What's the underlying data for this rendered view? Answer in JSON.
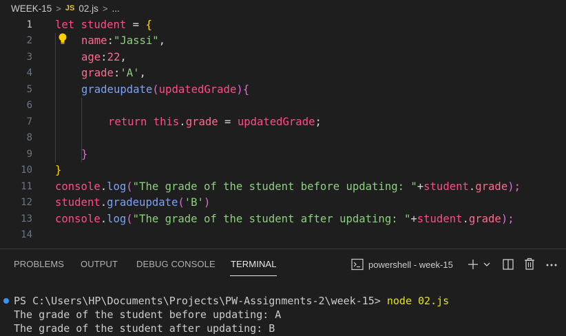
{
  "breadcrumb": {
    "folder": "WEEK-15",
    "file_icon": "JS",
    "file": "02.js",
    "more": "..."
  },
  "editor": {
    "line_numbers": [
      "1",
      "2",
      "3",
      "4",
      "5",
      "6",
      "7",
      "8",
      "9",
      "10",
      "11",
      "12",
      "13",
      "14"
    ],
    "lines": {
      "l1": {
        "kw": "let",
        "var": "student",
        "eq": " = ",
        "brace": "{"
      },
      "l2": {
        "prop": "name",
        "colon": ":",
        "str": "\"Jassi\"",
        "comma": ","
      },
      "l3": {
        "prop": "age",
        "colon": ":",
        "num": "22",
        "comma": ","
      },
      "l4": {
        "prop": "grade",
        "colon": ":",
        "str": "'A'",
        "comma": ","
      },
      "l5": {
        "fn": "gradeupdate",
        "open": "(",
        "param": "updatedGrade",
        "close": ")",
        "brace": "{"
      },
      "l7": {
        "kw": "return",
        "this": "this",
        "dot": ".",
        "prop": "grade",
        "eq": " = ",
        "param": "updatedGrade",
        "semi": ";"
      },
      "l9": {
        "brace": "}"
      },
      "l10": {
        "brace": "}"
      },
      "l11": {
        "obj": "console",
        "dot": ".",
        "fn": "log",
        "open": "(",
        "str": "\"The grade of the student before updating: \"",
        "plus": "+",
        "var": "student",
        "dot2": ".",
        "prop": "grade",
        "close": ");"
      },
      "l12": {
        "var": "student",
        "dot": ".",
        "fn": "gradeupdate",
        "open": "(",
        "str": "'B'",
        "close": ")"
      },
      "l13": {
        "obj": "console",
        "dot": ".",
        "fn": "log",
        "open": "(",
        "str": "\"The grade of the student after updating: \"",
        "plus": "+",
        "var": "student",
        "dot2": ".",
        "prop": "grade",
        "close": ");"
      }
    }
  },
  "panel": {
    "tabs": [
      "PROBLEMS",
      "OUTPUT",
      "DEBUG CONSOLE",
      "TERMINAL"
    ],
    "active_tab": "TERMINAL",
    "terminal_name": "powershell - week-15",
    "icons": [
      "terminal-icon",
      "plus-icon",
      "chevron-down-icon",
      "split-icon",
      "trash-icon",
      "more-icon"
    ]
  },
  "terminal": {
    "prompt": "PS C:\\Users\\HP\\Documents\\Projects\\PW-Assignments-2\\week-15> ",
    "command": "node 02.js",
    "output": [
      "The grade of the student before updating: A",
      "The grade of the student after updating: B"
    ]
  },
  "colors": {
    "keyword": "#ff4b8b",
    "string": "#8ccf7e",
    "function": "#7aa2f7",
    "brace": "#ffd700",
    "terminal_dot": "#3794ff"
  }
}
